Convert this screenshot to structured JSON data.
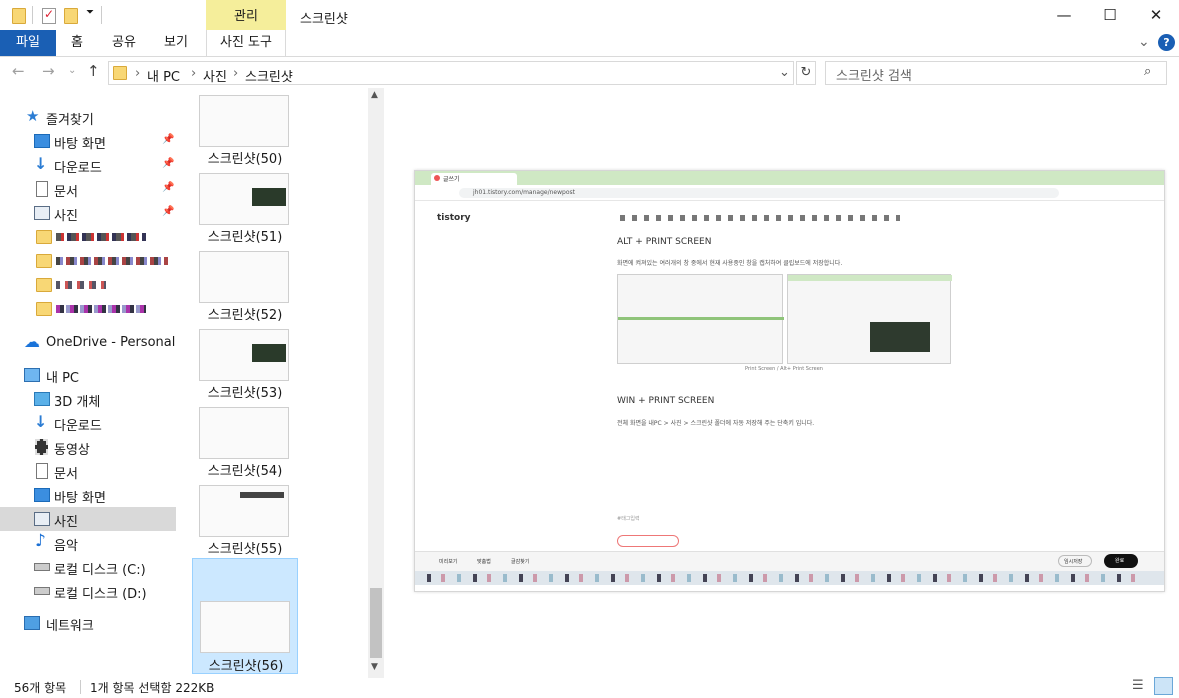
{
  "window": {
    "title": "스크린샷",
    "context_tab": "관리",
    "controls": {
      "minimize": "—",
      "maximize": "☐",
      "close": "✕"
    }
  },
  "ribbon": {
    "tabs": [
      "파일",
      "홈",
      "공유",
      "보기",
      "사진 도구"
    ],
    "help": "?",
    "expand": "⌄"
  },
  "address": {
    "crumbs": [
      "내 PC",
      "사진",
      "스크린샷"
    ],
    "search_placeholder": "스크린샷 검색"
  },
  "nav": {
    "quick_access": "즐겨찾기",
    "quick_items": [
      "바탕 화면",
      "다운로드",
      "문서",
      "사진"
    ],
    "onedrive": "OneDrive - Personal",
    "this_pc": "내 PC",
    "pc_items": [
      "3D 개체",
      "다운로드",
      "동영상",
      "문서",
      "바탕 화면",
      "사진",
      "음악",
      "로컬 디스크 (C:)",
      "로컬 디스크 (D:)"
    ],
    "network": "네트워크"
  },
  "files": [
    "스크린샷(50)",
    "스크린샷(51)",
    "스크린샷(52)",
    "스크린샷(53)",
    "스크린샷(54)",
    "스크린샷(55)",
    "스크린샷(56)"
  ],
  "preview": {
    "browser_tab": "글쓰기",
    "url": "jh01.tistory.com/manage/newpost",
    "logo": "tistory",
    "heading1": "ALT + PRINT SCREEN",
    "para1": "화면에 켜져있는 여러개의 창 중에서 현재 사용중인 창을 캡처하여 클립보드에 저장합니다.",
    "caption": "Print Screen  /  Alt+ Print Screen",
    "heading2": "WIN + PRINT SCREEN",
    "para2": "전체 화면을 내PC > 사진 > 스크린샷 폴더에 자동 저장해 주는 단축키 입니다.",
    "tag": "#태그입력",
    "bottom_left": [
      "미리보기",
      "맞춤법",
      "글감찾기"
    ],
    "publish": "완료",
    "temp_save": "임시저장"
  },
  "status": {
    "count": "56개 항목",
    "selection": "1개 항목 선택함 222KB"
  },
  "colors": {
    "accent": "#1a5fb4",
    "manage": "#f5ee9b",
    "selection": "#cce8ff"
  }
}
